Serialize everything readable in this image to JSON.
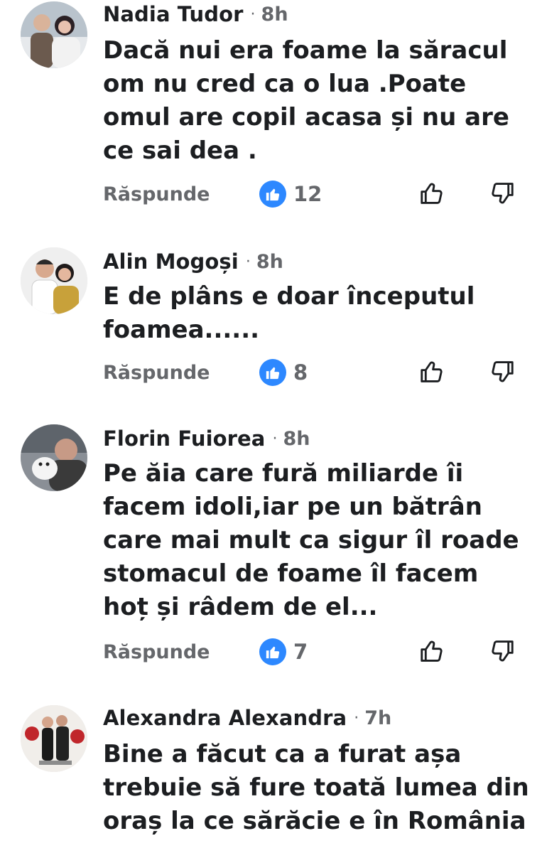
{
  "comments": [
    {
      "author": "Nadia Tudor",
      "time": "8h",
      "text": "Dacă nui era foame la săracul\nom nu cred ca o lua .Poate\nomul are copil acasa și nu are\nce sai dea .",
      "reply_label": "Răspunde",
      "reaction_count": "12"
    },
    {
      "author": "Alin Mogoși",
      "time": "8h",
      "text": "E de plâns  e doar începutul\nfoamea......",
      "reply_label": "Răspunde",
      "reaction_count": "8"
    },
    {
      "author": "Florin Fuiorea",
      "time": "8h",
      "text": "Pe ăia care fură miliarde îi\nfacem idoli,iar pe un bătrân\ncare mai mult ca sigur îl roade\nstomacul de foame îl facem\nhoț și râdem de el...",
      "reply_label": "Răspunde",
      "reaction_count": "7"
    },
    {
      "author": "Alexandra Alexandra",
      "time": "7h",
      "text": "Bine a făcut ca a furat așa\ntrebuie să fure toată lumea din\noraș la ce sărăcie e în România"
    }
  ],
  "separator": "·",
  "icons": {
    "like": "thumbs-up-filled",
    "upvote": "thumbs-up-outline",
    "downvote": "thumbs-down-outline"
  },
  "colors": {
    "like_badge": "#2d88ff",
    "secondary_text": "#65676b",
    "primary_text": "#1c1e21"
  }
}
